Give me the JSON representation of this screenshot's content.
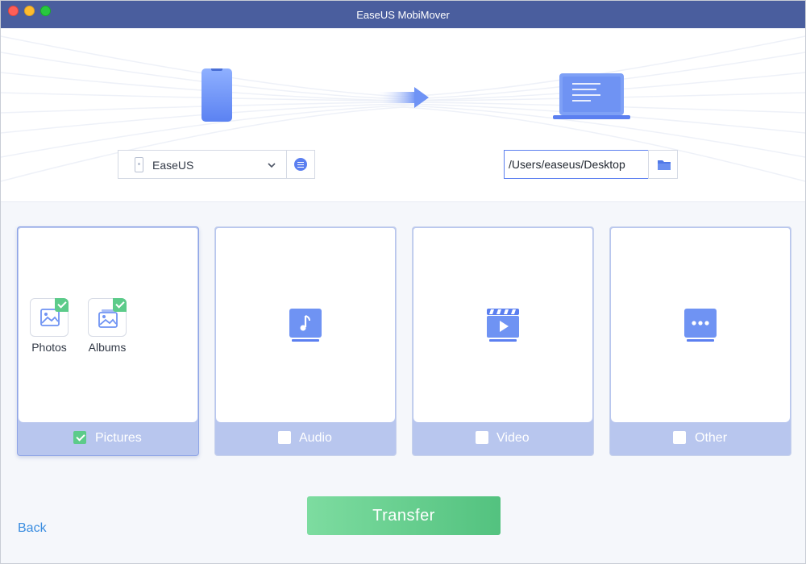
{
  "window": {
    "title": "EaseUS MobiMover"
  },
  "source": {
    "device_name": "EaseUS"
  },
  "destination": {
    "path": "/Users/easeus/Desktop"
  },
  "categories": [
    {
      "label": "Pictures",
      "checked": true,
      "sub_items": [
        {
          "label": "Photos",
          "checked": true
        },
        {
          "label": "Albums",
          "checked": true
        }
      ]
    },
    {
      "label": "Audio",
      "checked": false
    },
    {
      "label": "Video",
      "checked": false
    },
    {
      "label": "Other",
      "checked": false
    }
  ],
  "actions": {
    "transfer_label": "Transfer",
    "back_label": "Back"
  },
  "colors": {
    "titlebar": "#4a5e9e",
    "accent": "#5b7ff0",
    "card_footer": "#b8c6ee",
    "check_green": "#5ccb8a",
    "transfer_green": "#5dc887",
    "link_blue": "#3a8de0"
  },
  "icons": [
    "phone-icon",
    "transfer-arrow-icon",
    "laptop-icon",
    "chevron-down-icon",
    "device-info-icon",
    "folder-icon",
    "photo-icon",
    "album-icon",
    "music-icon",
    "video-icon",
    "more-icon"
  ]
}
